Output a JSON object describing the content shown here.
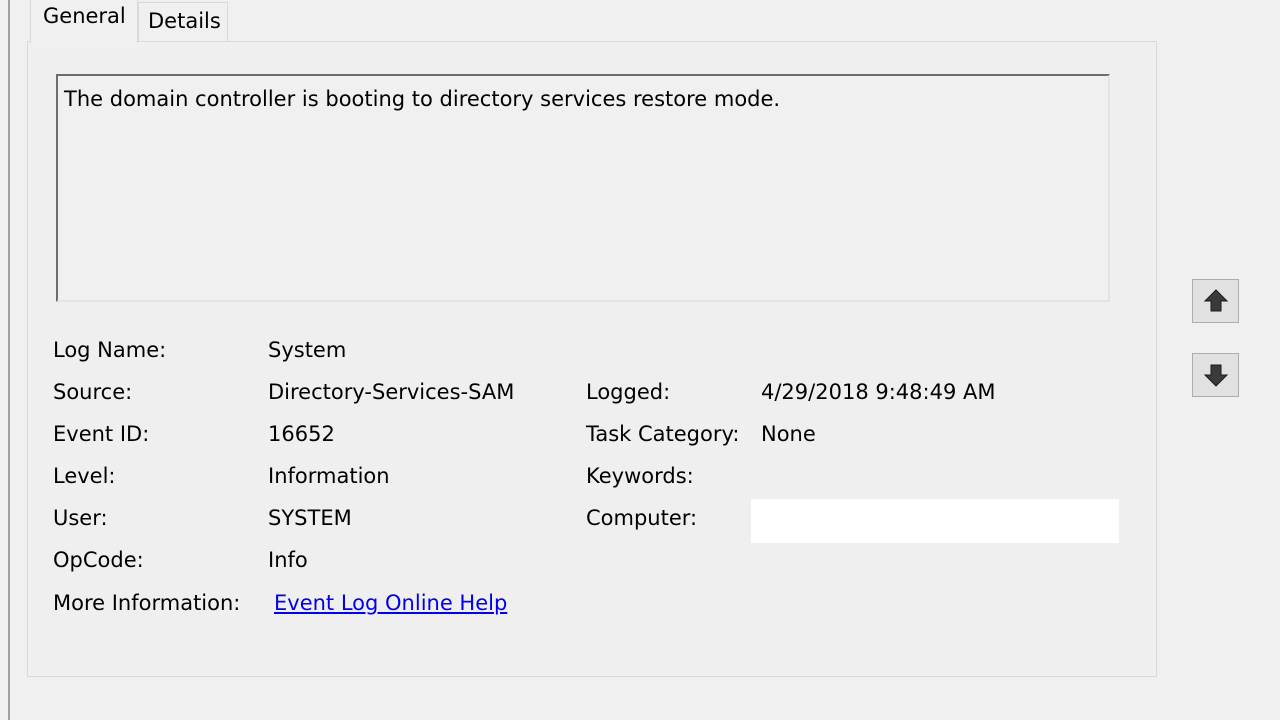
{
  "tabs": [
    {
      "label": "General",
      "selected": true
    },
    {
      "label": "Details",
      "selected": false
    }
  ],
  "description": "The domain controller is booting to directory services restore mode.",
  "fields": {
    "log_name": {
      "label": "Log Name:",
      "value": "System"
    },
    "source": {
      "label": "Source:",
      "value": "Directory-Services-SAM"
    },
    "event_id": {
      "label": "Event ID:",
      "value": "16652"
    },
    "level": {
      "label": "Level:",
      "value": "Information"
    },
    "user": {
      "label": "User:",
      "value": "SYSTEM"
    },
    "opcode": {
      "label": "OpCode:",
      "value": "Info"
    },
    "more_info": {
      "label": "More Information:",
      "link": "Event Log Online Help"
    },
    "logged": {
      "label": "Logged:",
      "value": "4/29/2018 9:48:49 AM"
    },
    "task_category": {
      "label": "Task Category:",
      "value": "None"
    },
    "keywords": {
      "label": "Keywords:",
      "value": ""
    },
    "computer": {
      "label": "Computer:",
      "value": ""
    }
  },
  "nav": {
    "up_icon": "arrow-up-icon",
    "down_icon": "arrow-down-icon"
  },
  "colors": {
    "link": "#0000ee",
    "background": "#f0f0f0"
  }
}
